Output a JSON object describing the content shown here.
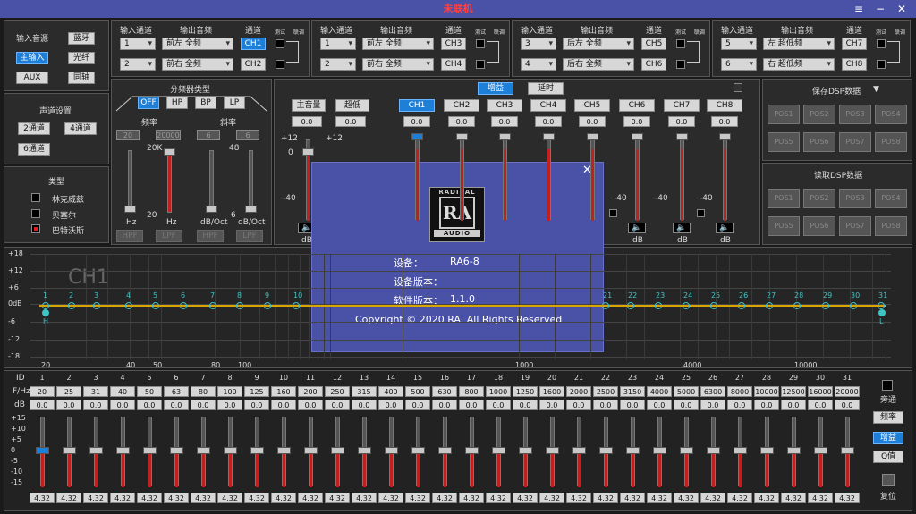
{
  "window": {
    "title": "未联机",
    "btn_min": "≡",
    "btn_max": "−",
    "btn_close": "✕"
  },
  "source": {
    "label": "输入音源",
    "bluetooth": "蓝牙",
    "main_input": "主输入",
    "optical": "光纤",
    "aux": "AUX",
    "coax": "同轴"
  },
  "channel_settings": {
    "label": "声道设置",
    "ch2": "2通道",
    "ch4": "4通道",
    "ch6": "6通道"
  },
  "filter_type": {
    "label": "类型",
    "items": [
      "林克威兹",
      "贝塞尔",
      "巴特沃斯"
    ]
  },
  "routing_groups": [
    {
      "in_label": "输入通道",
      "out_label": "输出音频",
      "ch_label": "通道",
      "test_label": "测试",
      "link_label": "联调",
      "rows": [
        {
          "in": "1",
          "out": "前左 全频",
          "ch": "CH1"
        },
        {
          "in": "2",
          "out": "前右 全频",
          "ch": "CH2"
        }
      ]
    },
    {
      "in_label": "输入通道",
      "out_label": "输出音频",
      "ch_label": "通道",
      "test_label": "测试",
      "link_label": "联调",
      "rows": [
        {
          "in": "1",
          "out": "前左 全频",
          "ch": "CH3"
        },
        {
          "in": "2",
          "out": "前右 全频",
          "ch": "CH4"
        }
      ]
    },
    {
      "in_label": "输入通道",
      "out_label": "输出音频",
      "ch_label": "通道",
      "test_label": "测试",
      "link_label": "联调",
      "rows": [
        {
          "in": "3",
          "out": "后左 全频",
          "ch": "CH5"
        },
        {
          "in": "4",
          "out": "后右 全频",
          "ch": "CH6"
        }
      ]
    },
    {
      "in_label": "输入通道",
      "out_label": "输出音频",
      "ch_label": "通道",
      "test_label": "测试",
      "link_label": "联调",
      "rows": [
        {
          "in": "5",
          "out": "左 超低频",
          "ch": "CH7"
        },
        {
          "in": "6",
          "out": "右 超低频",
          "ch": "CH8"
        }
      ]
    }
  ],
  "crossover": {
    "label": "分频器类型",
    "types": [
      "OFF",
      "HP",
      "BP",
      "LP"
    ],
    "freq_label": "频率",
    "slope_label": "斜率",
    "freq_vals": [
      "20",
      "20000"
    ],
    "slope_vals": [
      "6",
      "6"
    ],
    "top_left": "20K",
    "top_right": "48",
    "bottom_left": "20",
    "bottom_right": "6",
    "unit_hz": "Hz",
    "unit_hz2": "Hz",
    "unit_slope": "dB/Oct",
    "unit_slope2": "dB/Oct",
    "ctrl_labels": [
      "HPF",
      "LPF",
      "HPF",
      "LPF"
    ]
  },
  "gain": {
    "tab_gain": "增益",
    "tab_delay": "延时",
    "master": "主音量",
    "bass": "超低",
    "master_val": "0.0",
    "bass_val": "0.0",
    "channels": [
      "CH1",
      "CH2",
      "CH3",
      "CH4",
      "CH5",
      "CH6",
      "CH7",
      "CH8"
    ],
    "vals": [
      "0.0",
      "0.0",
      "0.0",
      "0.0",
      "0.0",
      "0.0",
      "0.0",
      "0.0"
    ],
    "scale_top": "+12",
    "scale_mid": "0",
    "scale_bot": "-40",
    "unit": "dB"
  },
  "presets": {
    "save_label": "保存DSP数据",
    "load_label": "读取DSP数据",
    "save": [
      "POS1",
      "POS2",
      "POS3",
      "POS4",
      "POS5",
      "POS6",
      "POS7",
      "POS8"
    ],
    "load": [
      "POS1",
      "POS2",
      "POS3",
      "POS4",
      "POS5",
      "POS6",
      "POS7",
      "POS8"
    ]
  },
  "graph": {
    "channel": "CH1",
    "y_ticks": [
      "+18",
      "+12",
      "+6",
      "0dB",
      "-6",
      "-12",
      "-18"
    ],
    "x_ticks": [
      "20",
      "40",
      "50",
      "80",
      "100",
      "1000",
      "4000",
      "10000"
    ],
    "points": [
      "1",
      "2",
      "3",
      "4",
      "5",
      "6",
      "7",
      "8",
      "9",
      "10",
      "21",
      "22",
      "23",
      "24",
      "25",
      "26",
      "27",
      "28",
      "29",
      "30",
      "31"
    ],
    "hp_label": "H",
    "lp_label": "L"
  },
  "eq": {
    "id_label": "ID",
    "f_label": "F/Hz",
    "db_label": "dB",
    "ids": [
      "1",
      "2",
      "3",
      "4",
      "5",
      "6",
      "7",
      "8",
      "9",
      "10",
      "11",
      "12",
      "13",
      "14",
      "15",
      "16",
      "17",
      "18",
      "19",
      "20",
      "21",
      "22",
      "23",
      "24",
      "25",
      "26",
      "27",
      "28",
      "29",
      "30",
      "31"
    ],
    "freqs": [
      "20",
      "25",
      "31",
      "40",
      "50",
      "63",
      "80",
      "100",
      "125",
      "160",
      "200",
      "250",
      "315",
      "400",
      "500",
      "630",
      "800",
      "1000",
      "1250",
      "1600",
      "2000",
      "2500",
      "3150",
      "4000",
      "5000",
      "6300",
      "8000",
      "10000",
      "12500",
      "16000",
      "20000"
    ],
    "dbs": [
      "0.0",
      "0.0",
      "0.0",
      "0.0",
      "0.0",
      "0.0",
      "0.0",
      "0.0",
      "0.0",
      "0.0",
      "0.0",
      "0.0",
      "0.0",
      "0.0",
      "0.0",
      "0.0",
      "0.0",
      "0.0",
      "0.0",
      "0.0",
      "0.0",
      "0.0",
      "0.0",
      "0.0",
      "0.0",
      "0.0",
      "0.0",
      "0.0",
      "0.0",
      "0.0",
      "0.0"
    ],
    "qs": [
      "4.32",
      "4.32",
      "4.32",
      "4.32",
      "4.32",
      "4.32",
      "4.32",
      "4.32",
      "4.32",
      "4.32",
      "4.32",
      "4.32",
      "4.32",
      "4.32",
      "4.32",
      "4.32",
      "4.32",
      "4.32",
      "4.32",
      "4.32",
      "4.32",
      "4.32",
      "4.32",
      "4.32",
      "4.32",
      "4.32",
      "4.32",
      "4.32",
      "4.32",
      "4.32",
      "4.32"
    ],
    "scale": [
      "+15",
      "+10",
      "+5",
      "0",
      "-5",
      "-10",
      "-15"
    ],
    "bypass": "旁通",
    "freq_btn": "频率",
    "gain_btn": "增益",
    "q_btn": "Q值",
    "reset": "复位"
  },
  "dialog": {
    "device_label": "设备：",
    "device": "RA6-8",
    "ver_label": "设备版本：",
    "ver": "",
    "sw_label": "软件版本：",
    "sw": "1.1.0",
    "copyright": "Copyright © 2020 RA. All Rights Reserved",
    "logo_top": "RADICAL",
    "logo_mid": "RA",
    "logo_bot": "AUDIO",
    "close": "✕"
  }
}
